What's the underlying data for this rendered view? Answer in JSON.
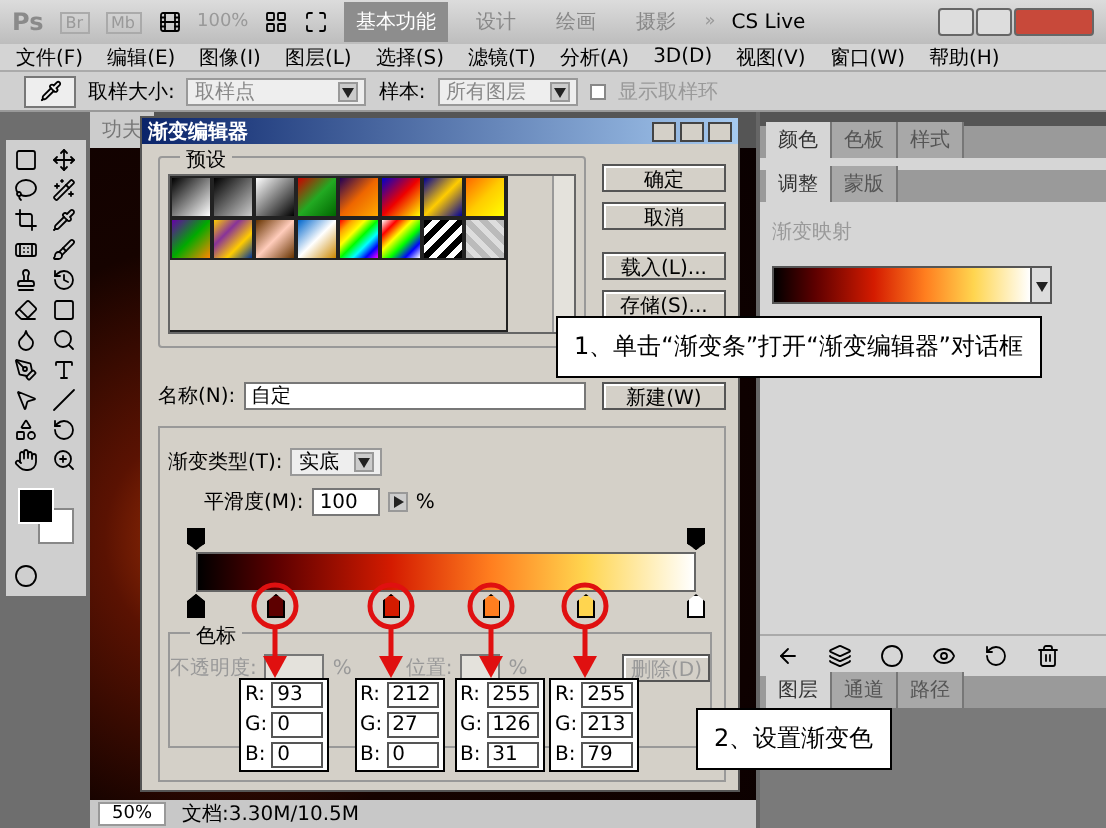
{
  "app_bar": {
    "logo": "Ps",
    "apps": [
      "Br",
      "Mb"
    ],
    "zoom": "100%",
    "workspaces": [
      {
        "label": "基本功能",
        "selected": true
      },
      {
        "label": "设计",
        "selected": false
      },
      {
        "label": "绘画",
        "selected": false
      },
      {
        "label": "摄影",
        "selected": false
      }
    ],
    "more": "»",
    "cs_live": "CS Live"
  },
  "menu": [
    "文件(F)",
    "编辑(E)",
    "图像(I)",
    "图层(L)",
    "选择(S)",
    "滤镜(T)",
    "分析(A)",
    "3D(D)",
    "视图(V)",
    "窗口(W)",
    "帮助(H)"
  ],
  "options_bar": {
    "sample_size_label": "取样大小:",
    "sample_size": "取样点",
    "sample_label": "样本:",
    "sample": "所有图层",
    "show_ring": {
      "label": "显示取样环",
      "checked": false
    }
  },
  "document": {
    "tab": "功夫",
    "zoom": "50%",
    "info": "文档:3.30M/10.5M"
  },
  "dialog": {
    "title": "渐变编辑器",
    "presets_label": "预设",
    "buttons": [
      "确定",
      "取消",
      "载入(L)...",
      "存储(S)..."
    ],
    "name_label": "名称(N):",
    "name": "自定",
    "new_button": "新建(W)",
    "type_label": "渐变类型(T):",
    "type": "实底",
    "smoothness_label": "平滑度(M):",
    "smoothness": "100",
    "smoothness_unit": "%",
    "stops": [
      {
        "color": "#000000",
        "level": 0,
        "selected": true
      },
      {
        "color": "#5d0000",
        "level": 0.16,
        "selected": false,
        "readout": [
          {
            "label": "R:",
            "value": "93"
          },
          {
            "label": "G:",
            "value": "0"
          },
          {
            "label": "B:",
            "value": "0"
          }
        ]
      },
      {
        "color": "#d41b00",
        "level": 0.39,
        "selected": false,
        "readout": [
          {
            "label": "R:",
            "value": "212"
          },
          {
            "label": "G:",
            "value": "27"
          },
          {
            "label": "B:",
            "value": "0"
          }
        ]
      },
      {
        "color": "#ff7e1f",
        "level": 0.59,
        "selected": false,
        "readout": [
          {
            "label": "R:",
            "value": "255"
          },
          {
            "label": "G:",
            "value": "126"
          },
          {
            "label": "B:",
            "value": "31"
          }
        ]
      },
      {
        "color": "#ffd54f",
        "level": 0.78,
        "selected": false,
        "readout": [
          {
            "label": "R:",
            "value": "255"
          },
          {
            "label": "G:",
            "value": "213"
          },
          {
            "label": "B:",
            "value": "79"
          }
        ]
      },
      {
        "color": "#ffffff",
        "level": 1,
        "selected": false
      }
    ],
    "stops_group": {
      "label": "色标",
      "opacity_label": "不透明度:",
      "opacity_unit": "%",
      "location_label": "位置:",
      "location_unit": "%",
      "delete_button": "删除(D)"
    }
  },
  "panels": {
    "top_tabs": [
      {
        "label": "颜色",
        "selected": true
      },
      {
        "label": "色板",
        "selected": false
      },
      {
        "label": "样式",
        "selected": false
      }
    ],
    "adjust_tabs": [
      {
        "label": "调整",
        "selected": true
      },
      {
        "label": "蒙版",
        "selected": false
      }
    ],
    "adjust_title": "渐变映射",
    "layer_tabs": [
      {
        "label": "图层",
        "selected": true
      },
      {
        "label": "通道",
        "selected": false
      },
      {
        "label": "路径",
        "selected": false
      }
    ]
  },
  "callouts": [
    {
      "text": "1、单击“渐变条”打开“渐变编辑器”对话框"
    },
    {
      "text": "2、设置渐变色"
    }
  ]
}
